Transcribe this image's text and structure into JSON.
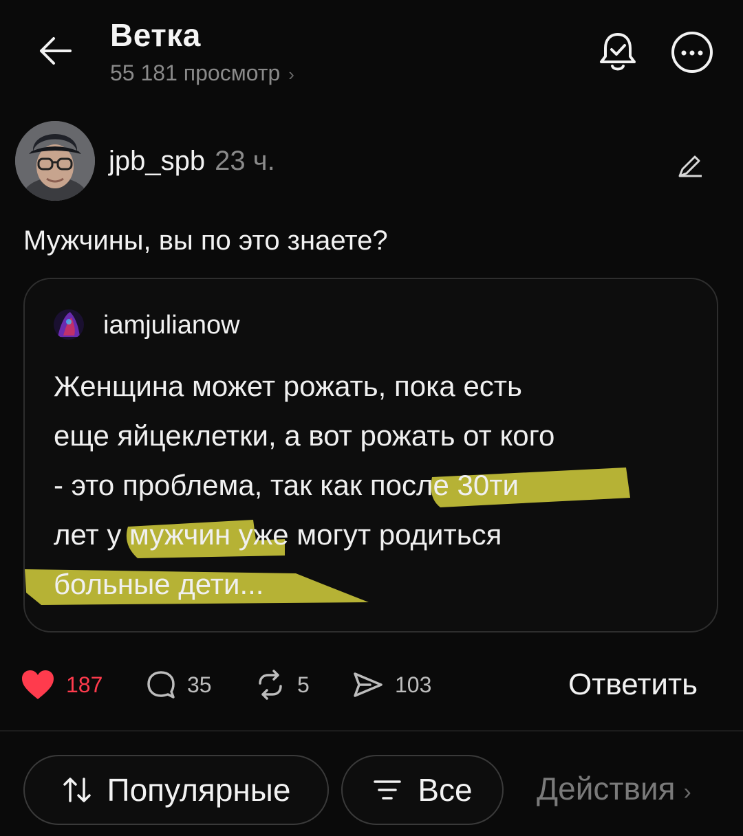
{
  "header": {
    "title": "Ветка",
    "views": "55 181 просмотр",
    "views_chevron": "›"
  },
  "post": {
    "author": "jpb_spb",
    "time": "23 ч.",
    "text": "Мужчины, вы по это знаете?"
  },
  "quote": {
    "author": "iamjulianow",
    "lines": [
      "Женщина может рожать, пока есть",
      "еще яйцеклетки, а вот рожать от кого",
      "- это проблема, так как после 30ти",
      "лет у мужчин уже могут родиться",
      "больные дети..."
    ],
    "highlight_color": "#c9c43a"
  },
  "actions": {
    "likes": "187",
    "comments": "35",
    "reposts": "5",
    "shares": "103",
    "reply_label": "Ответить",
    "like_color": "#ff3b4d"
  },
  "filters": {
    "sort_label": "Популярные",
    "filter_label": "Все",
    "actions_label": "Действия",
    "actions_chevron": "›"
  },
  "icons": {
    "back": "arrow-left-icon",
    "bell": "bell-check-icon",
    "more": "more-circle-icon",
    "edit": "pen-icon",
    "like": "heart-icon",
    "comment": "comment-bubble-icon",
    "repost": "repost-icon",
    "share": "send-icon",
    "sort": "sort-arrows-icon",
    "filter": "filter-lines-icon"
  }
}
